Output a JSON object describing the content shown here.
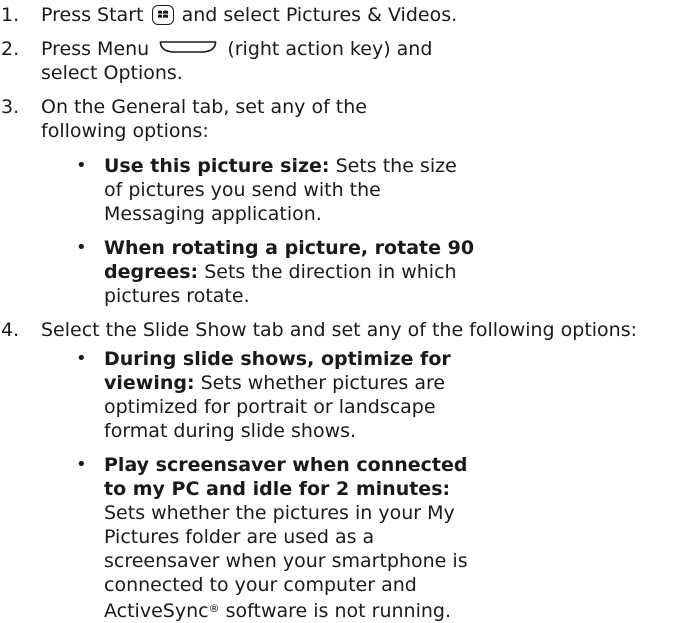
{
  "steps": [
    {
      "number": "1.",
      "lines": [
        "Press Start",
        "and select Pictures & Videos."
      ]
    },
    {
      "number": "2.",
      "lines": [
        "Press Menu",
        "(right action key) and",
        "select Options."
      ]
    },
    {
      "number": "3.",
      "lines": [
        "On the General tab, set any of the",
        "following options:"
      ],
      "bullets": [
        {
          "title_lines": [
            "Use this picture size:"
          ],
          "lines": [
            "Sets the size",
            "of pictures you send with the",
            "Messaging application."
          ]
        },
        {
          "title_lines": [
            "When rotating a picture, rotate 90",
            "degrees:"
          ],
          "lines": [
            "Sets the direction in which",
            "pictures rotate."
          ]
        }
      ]
    },
    {
      "number": "4.",
      "lines": [
        "Select the Slide Show tab and set any of the following options:"
      ],
      "bullets": [
        {
          "title_lines": [
            "During slide shows, optimize for",
            "viewing:"
          ],
          "lines": [
            "Sets whether pictures are",
            "optimized for portrait or landscape",
            "format during slide shows."
          ]
        },
        {
          "title_lines": [
            "Play screensaver when connected",
            "to my PC and idle for 2 minutes:"
          ],
          "lines": [
            "Sets whether the pictures in your My",
            "Pictures folder are used as a",
            "screensaver when your smartphone is",
            "connected to your computer and",
            "ActiveSync",
            "software is not running."
          ],
          "registered_mark": "®"
        }
      ]
    }
  ],
  "bullet_glyph": "•",
  "icons": {
    "start": "windows-start-key-icon",
    "menu": "right-action-key-icon"
  }
}
